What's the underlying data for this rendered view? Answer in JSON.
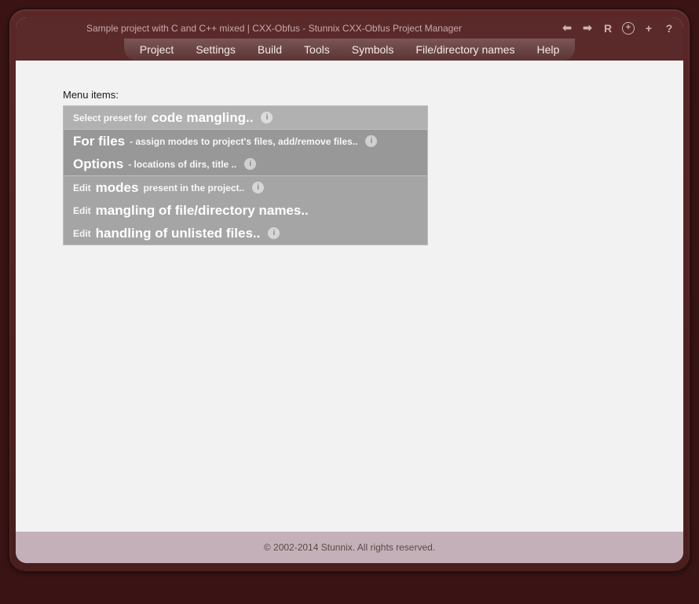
{
  "title": "Sample project with C and C++ mixed | CXX-Obfus - Stunnix CXX-Obfus Project Manager",
  "toolbar": {
    "back": "⬅",
    "forward": "➡",
    "reload": "R",
    "zoom": "+",
    "plus": "+",
    "help": "?"
  },
  "menubar": {
    "project": "Project",
    "settings": "Settings",
    "build": "Build",
    "tools": "Tools",
    "symbols": "Symbols",
    "filedir": "File/directory names",
    "help": "Help"
  },
  "content": {
    "heading": "Menu items:",
    "rows": {
      "preset": {
        "prefix": "Select preset for",
        "main": "code mangling.."
      },
      "forfiles": {
        "main": "For files",
        "desc": "- assign modes to project's files, add/remove files.."
      },
      "options": {
        "main": "Options",
        "desc": "- locations of dirs, title .."
      },
      "modes": {
        "prefix": "Edit",
        "main": "modes",
        "desc": "present in the project.."
      },
      "mangling": {
        "prefix": "Edit",
        "main": "mangling of file/directory names.."
      },
      "unlisted": {
        "prefix": "Edit",
        "main": "handling of unlisted files.."
      }
    }
  },
  "footer": "© 2002-2014 Stunnix. All rights reserved.",
  "info_glyph": "i"
}
